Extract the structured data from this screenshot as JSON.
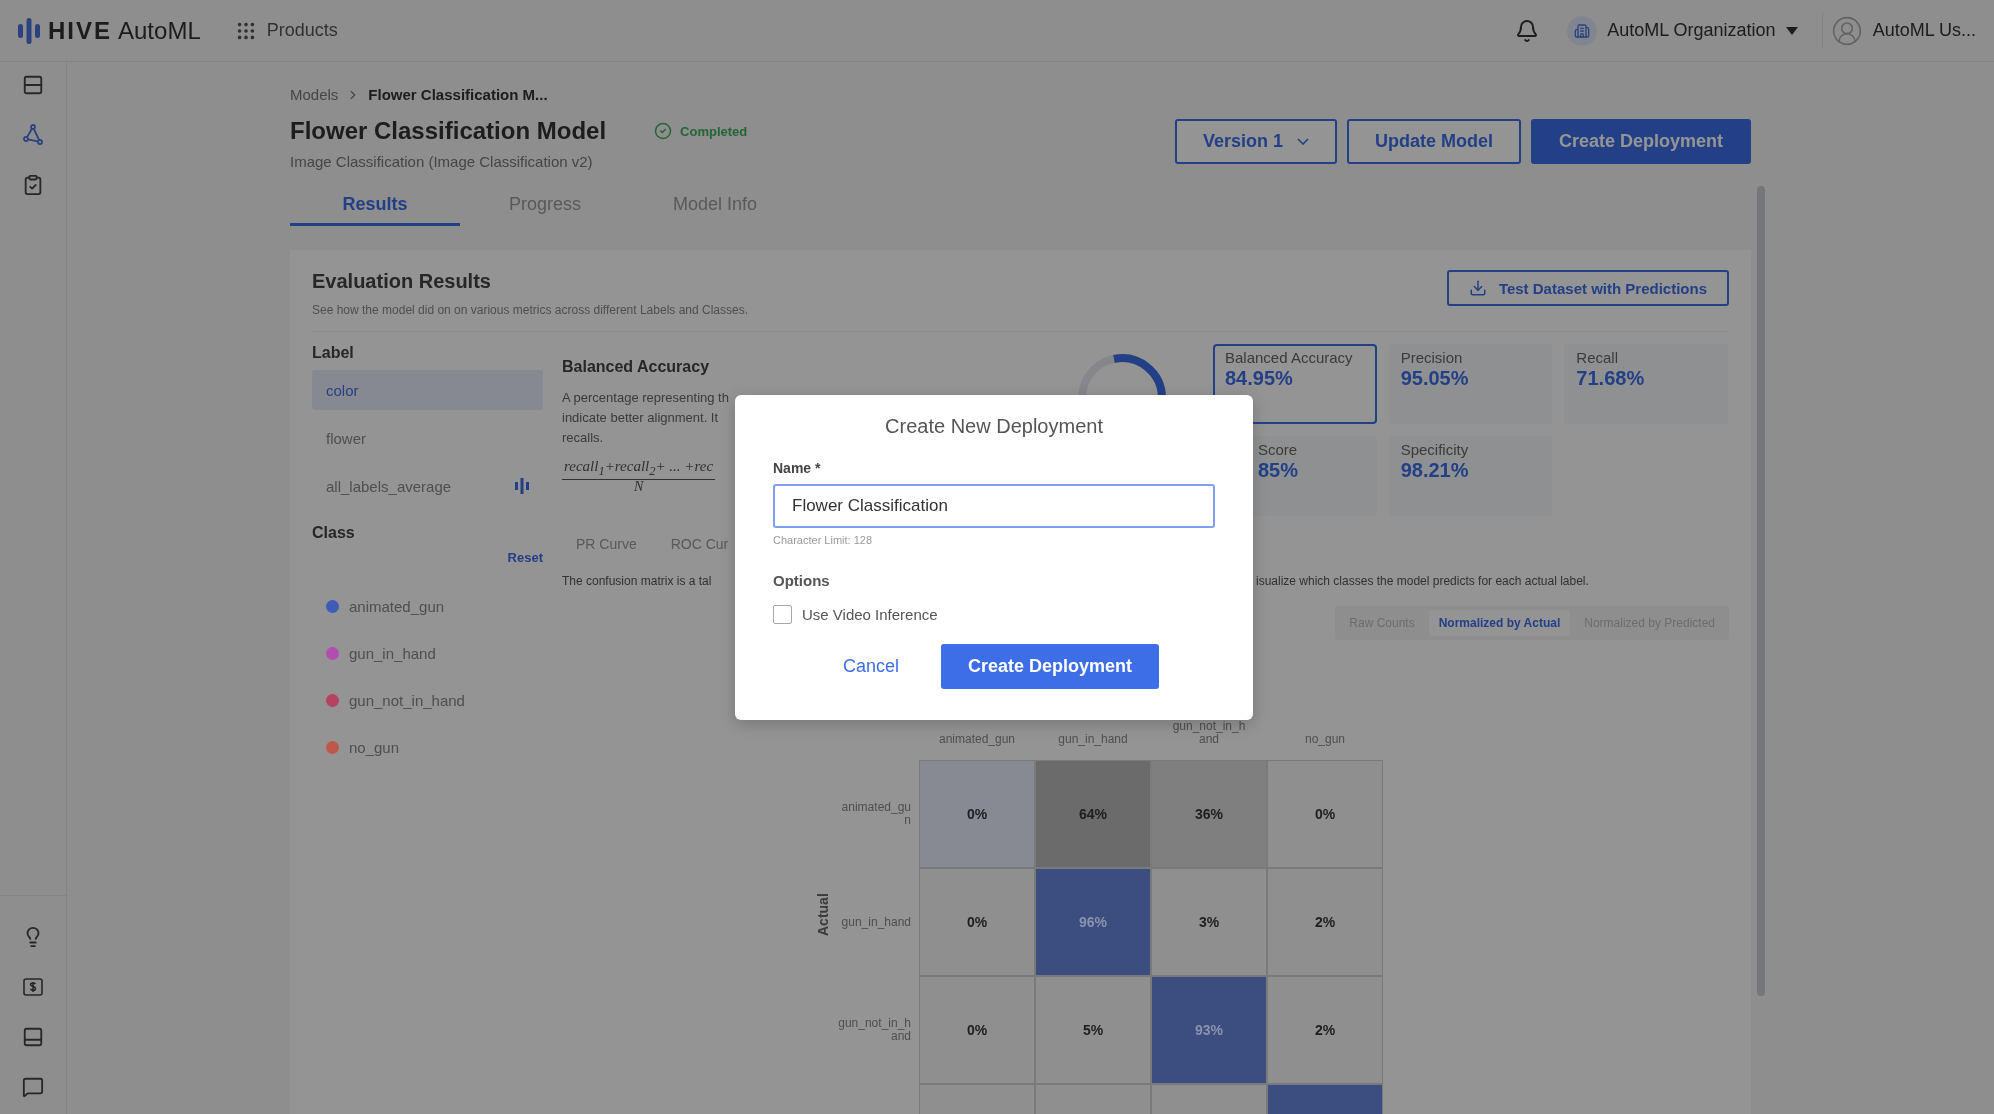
{
  "topbar": {
    "logo_bold": "HIVE",
    "logo_text": "AutoML",
    "products": "Products",
    "organization": "AutoML Organization",
    "user": "AutoML Us..."
  },
  "breadcrumb": [
    "Models",
    "Flower Classification M..."
  ],
  "header": {
    "title": "Flower Classification Model",
    "status": "Completed",
    "subtitle": "Image Classification (Image Classification v2)",
    "buttons": [
      {
        "label": "Version 1",
        "kind": "dropdown"
      },
      {
        "label": "Update Model",
        "kind": "outline"
      },
      {
        "label": "Create Deployment",
        "kind": "primary"
      }
    ]
  },
  "tabs": [
    {
      "label": "Results",
      "selected": true
    },
    {
      "label": "Progress",
      "selected": false
    },
    {
      "label": "Model Info",
      "selected": false
    }
  ],
  "evaluation": {
    "title": "Evaluation Results",
    "subtitle": "See how the model did on on various metrics across different Labels and Classes.",
    "download_button": "Test Dataset with Predictions"
  },
  "labels": {
    "heading": "Label",
    "items": [
      {
        "label": "color",
        "selected": true
      },
      {
        "label": "flower",
        "selected": false
      },
      {
        "label": "all_labels_average",
        "selected": false
      }
    ]
  },
  "classes": {
    "heading": "Class",
    "reset": "Reset",
    "items": [
      {
        "label": "animated_gun",
        "color": "#3e5bb5"
      },
      {
        "label": "gun_in_hand",
        "color": "#b04fb0"
      },
      {
        "label": "gun_not_in_hand",
        "color": "#b84060"
      },
      {
        "label": "no_gun",
        "color": "#c0584a"
      }
    ]
  },
  "metric_detail": {
    "title": "Balanced Accuracy",
    "description_lines": [
      "A percentage representing th",
      "indicate better alignment. It",
      "recalls."
    ],
    "formula_numerator": "recall$_{1}$+recall$_{2}$+ ... +rec",
    "formula_denominator": "N"
  },
  "metrics": [
    {
      "label": "Balanced Accuracy",
      "value": "84.95%",
      "selected": true
    },
    {
      "label": "Precision",
      "value": "95.05%",
      "selected": false
    },
    {
      "label": "Recall",
      "value": "71.68%",
      "selected": false
    },
    {
      "label": "Score",
      "value": "85%",
      "selected": false
    },
    {
      "label": "Specificity",
      "value": "98.21%",
      "selected": false
    }
  ],
  "chart_tabs": [
    {
      "label": "PR Curve"
    },
    {
      "label": "ROC Cur"
    }
  ],
  "confusion_text": [
    "The confusion matrix is a tal",
    "isualize which classes the model predicts for each actual label."
  ],
  "normalization": [
    {
      "label": "Raw Counts",
      "selected": false
    },
    {
      "label": "Normalized by Actual",
      "selected": true
    },
    {
      "label": "Normalized by Predicted",
      "selected": false
    }
  ],
  "matrix": {
    "axis_label": "Actual",
    "columns": [
      "animated_gun",
      "gun_in_hand",
      "gun_not_in_hand",
      "no_gun"
    ],
    "rows": [
      {
        "label": "animated_gun",
        "cells": [
          {
            "value": "0%",
            "color": "#878a92"
          },
          {
            "value": "64%",
            "color": "#6b6b6b"
          },
          {
            "value": "36%",
            "color": "#7f7f7f"
          },
          {
            "value": "0%",
            "color": "#8f8f8f"
          }
        ]
      },
      {
        "label": "gun_in_hand",
        "cells": [
          {
            "value": "0%",
            "color": "#8f8f8f"
          },
          {
            "value": "96%",
            "color": "#3c4d80"
          },
          {
            "value": "3%",
            "color": "#8f8f8f"
          },
          {
            "value": "2%",
            "color": "#8f8f8f"
          }
        ]
      },
      {
        "label": "gun_not_in_hand",
        "cells": [
          {
            "value": "0%",
            "color": "#8f8f8f"
          },
          {
            "value": "5%",
            "color": "#8f8f8f"
          },
          {
            "value": "93%",
            "color": "#3c4d80"
          },
          {
            "value": "2%",
            "color": "#8f8f8f"
          }
        ]
      },
      {
        "cells": [
          {
            "color": "#8f8f8f"
          },
          {
            "color": "#8f8f8f"
          },
          {
            "color": "#8f8f8f"
          },
          {
            "color": "#3c4d80"
          }
        ]
      }
    ]
  },
  "dialog": {
    "title": "Create New Deployment",
    "name_label": "Name *",
    "name_value": "Flower Classification",
    "hint": "Character Limit: 128",
    "options_heading": "Options",
    "option": {
      "label": "Use Video Inference",
      "checked": false
    },
    "cancel": "Cancel",
    "confirm": "Create Deployment"
  }
}
